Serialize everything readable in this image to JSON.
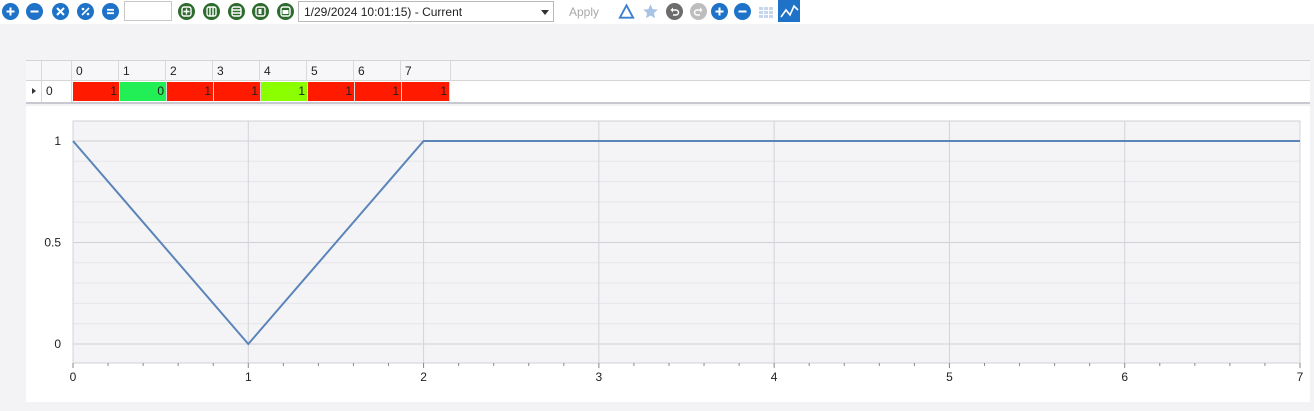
{
  "toolbar": {
    "icons": [
      "add-icon",
      "remove-icon",
      "close-icon",
      "percent-icon",
      "equals-icon",
      "grid-plus-icon",
      "columns-icon",
      "rows-icon",
      "layout-d-icon",
      "layout-box-icon",
      "triangle-icon",
      "star-icon",
      "undo-icon",
      "redo-icon",
      "zoom-in-icon",
      "zoom-out-icon",
      "grid-icon",
      "chart-icon"
    ],
    "value_input": "",
    "timestamp_select": "1/29/2024 10:01:15) - Current",
    "apply_label": "Apply"
  },
  "grid": {
    "columns": [
      "0",
      "1",
      "2",
      "3",
      "4",
      "5",
      "6",
      "7"
    ],
    "row_index": "0",
    "values": [
      "1",
      "0",
      "1",
      "1",
      "1",
      "1",
      "1",
      "1"
    ],
    "colors": [
      "#ff1a00",
      "#22ee55",
      "#ff1a00",
      "#ff1a00",
      "#8bff00",
      "#ff1a00",
      "#ff1a00",
      "#ff1a00"
    ]
  },
  "chart_data": {
    "type": "line",
    "x": [
      0,
      1,
      2,
      3,
      4,
      5,
      6,
      7
    ],
    "series": [
      {
        "values": [
          1,
          0,
          1,
          1,
          1,
          1,
          1,
          1
        ],
        "color": "#5b84b8"
      }
    ],
    "xlim": [
      0,
      7
    ],
    "ylim": [
      0,
      1
    ],
    "xticks": [
      "0",
      "1",
      "2",
      "3",
      "4",
      "5",
      "6",
      "7"
    ],
    "yticks": [
      "0",
      "0.5",
      "1"
    ],
    "grid": true
  }
}
